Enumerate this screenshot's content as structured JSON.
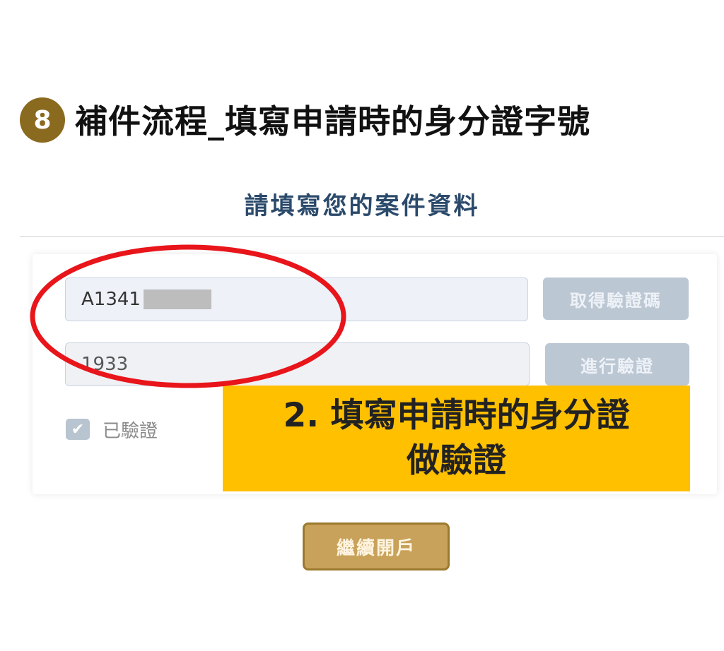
{
  "step": {
    "number": "8",
    "title": "補件流程_填寫申請時的身分證字號"
  },
  "form": {
    "section_title": "請填寫您的案件資料",
    "id_field": {
      "value": "A1341"
    },
    "get_code_button": "取得驗證碼",
    "code_field": {
      "value": "1933"
    },
    "verify_button": "進行驗證",
    "verified": {
      "checked": true,
      "label": "已驗證"
    },
    "continue_button": "繼續開戶"
  },
  "callout": {
    "line1": "2. 填寫申請時的身分證",
    "line2": "做驗證"
  },
  "colors": {
    "badge": "#8a6a1f",
    "section_title": "#2b4a6b",
    "callout_bg": "#ffc000",
    "highlight_ellipse": "#e8151b",
    "continue_button": "#c8a25a"
  }
}
